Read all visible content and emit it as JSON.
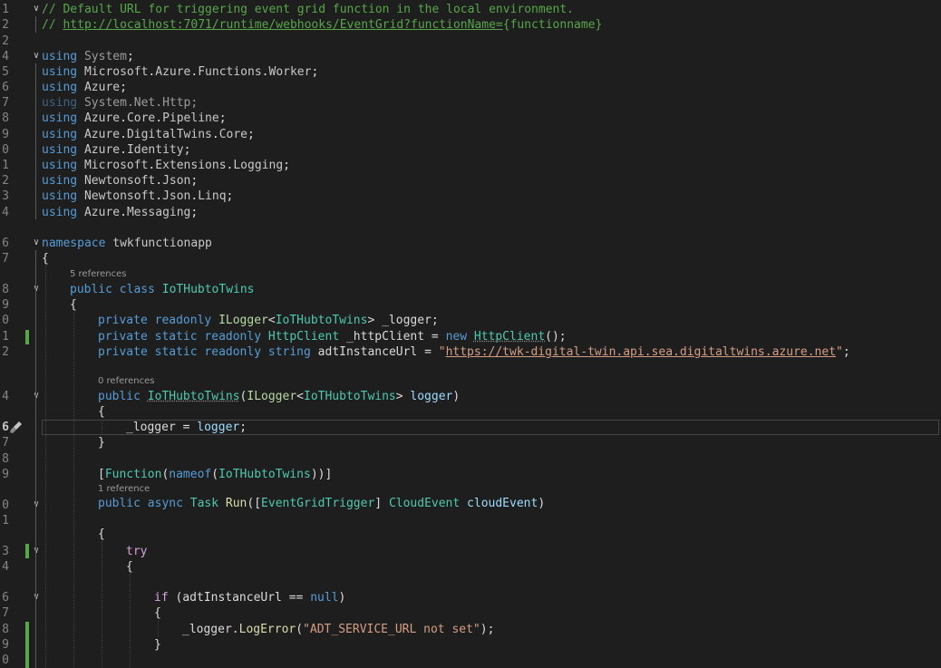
{
  "line_numbers": [
    "1",
    "2",
    "2",
    "4",
    "5",
    "6",
    "7",
    "8",
    "9",
    "0",
    "1",
    "2",
    "3",
    "4",
    "6",
    "7",
    "8",
    "9",
    "0",
    "1",
    "2",
    "4",
    "6",
    "7",
    "8",
    "9",
    "0",
    "1",
    "3",
    "4",
    "6",
    "7",
    "8",
    "9",
    "0"
  ],
  "codelens": {
    "class_refs": "5 references",
    "ctor_refs": "0 references",
    "run_refs": "1 reference"
  },
  "code": {
    "comment1": "// Default URL for triggering event grid function in the local environment.",
    "comment2_prefix": "// ",
    "comment2_url": "http://localhost:7071/runtime/webhooks/EventGrid?functionName=",
    "comment2_suffix": "{functionname}",
    "kw_using": "using",
    "u1": "System",
    "u2a": "Microsoft",
    "u2b": "Azure",
    "u2c": "Functions",
    "u2d": "Worker",
    "u3": "Azure",
    "u4a": "System",
    "u4b": "Net",
    "u4c": "Http",
    "u5a": "Azure",
    "u5b": "Core",
    "u5c": "Pipeline",
    "u6a": "Azure",
    "u6b": "DigitalTwins",
    "u6c": "Core",
    "u7a": "Azure",
    "u7b": "Identity",
    "u8a": "Microsoft",
    "u8b": "Extensions",
    "u8c": "Logging",
    "u9a": "Newtonsoft",
    "u9b": "Json",
    "u10a": "Newtonsoft",
    "u10b": "Json",
    "u10c": "Linq",
    "u11a": "Azure",
    "u11b": "Messaging",
    "kw_namespace": "namespace",
    "ns_name": "twkfunctionapp",
    "kw_public": "public",
    "kw_class": "class",
    "class_name": "IoTHubtoTwins",
    "kw_private": "private",
    "kw_readonly": "readonly",
    "kw_static": "static",
    "kw_string": "string",
    "kw_new": "new",
    "kw_async": "async",
    "t_ilogger": "ILogger",
    "t_httpclient": "HttpClient",
    "t_task": "Task",
    "t_function": "Function",
    "t_egtrigger": "EventGridTrigger",
    "t_cloudevent": "CloudEvent",
    "f_logger": "_logger",
    "f_http": "_httpClient",
    "f_adt": "adtInstanceUrl",
    "url_value": "https://twk-digital-twin.api.sea.digitaltwins.azure.net",
    "p_logger": "logger",
    "kw_nameof": "nameof",
    "m_run": "Run",
    "p_cloudevent": "cloudEvent",
    "kw_try": "try",
    "kw_if": "if",
    "kw_null": "null",
    "m_logerror": "LogError",
    "err_msg": "\"ADT_SERVICE_URL not set\""
  }
}
